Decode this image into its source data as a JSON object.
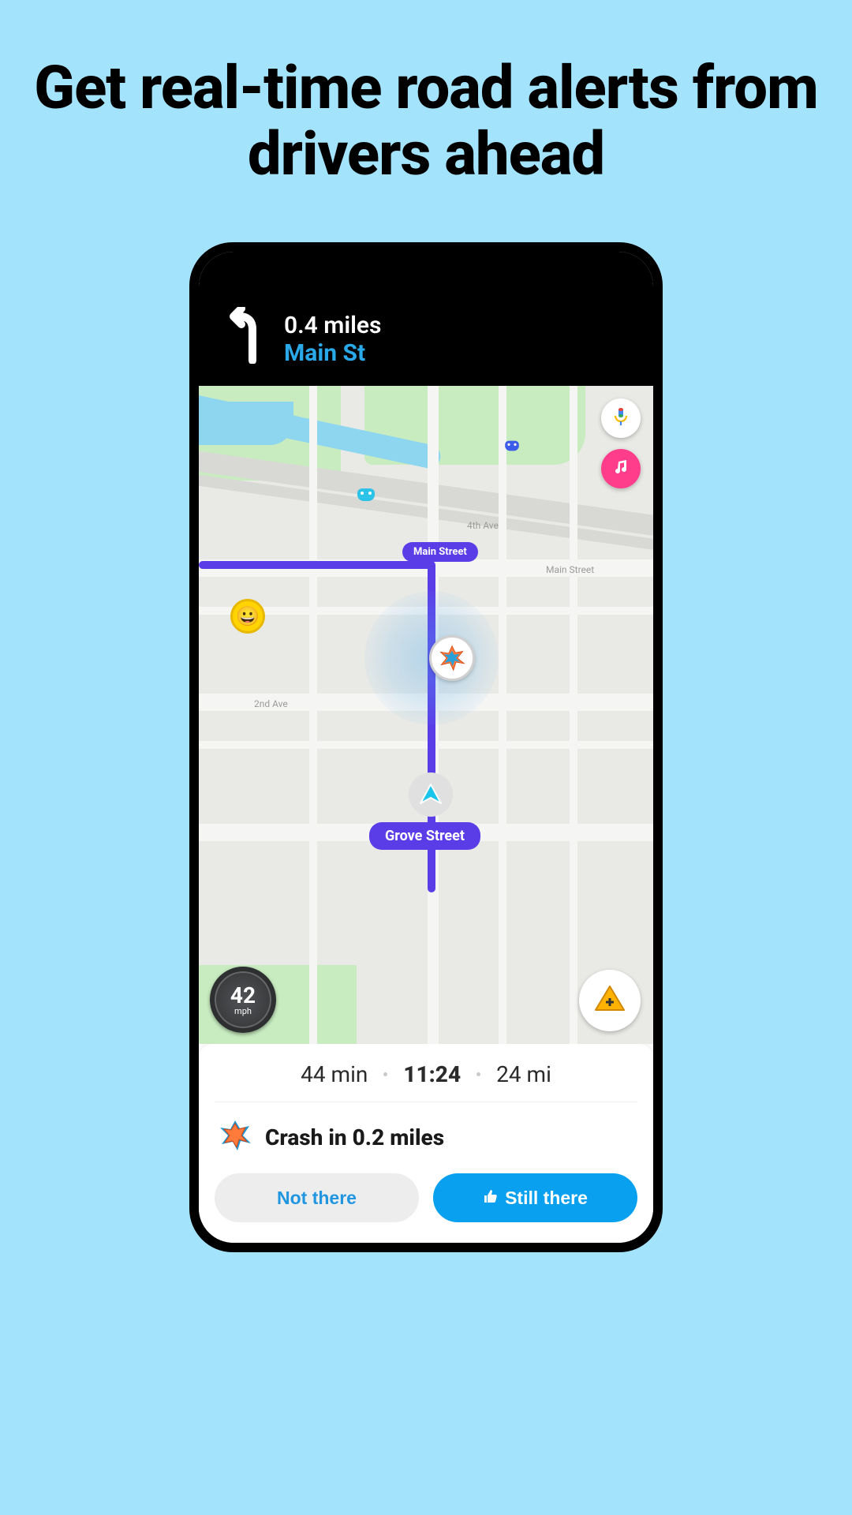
{
  "headline": "Get real-time road alerts from drivers ahead",
  "nav": {
    "distance": "0.4 miles",
    "street": "Main St"
  },
  "map": {
    "labels": {
      "fourth_ave": "4th Ave",
      "main_street": "Main Street",
      "second_ave": "2nd Ave",
      "main_bubble": "Main Street",
      "grove_bubble": "Grove Street"
    },
    "speed": {
      "value": "42",
      "unit": "mph"
    }
  },
  "eta": {
    "duration": "44 min",
    "arrival": "11:24",
    "distance": "24 mi"
  },
  "alert": {
    "text": "Crash in 0.2 miles"
  },
  "buttons": {
    "not_there": "Not there",
    "still_there": "Still there"
  }
}
